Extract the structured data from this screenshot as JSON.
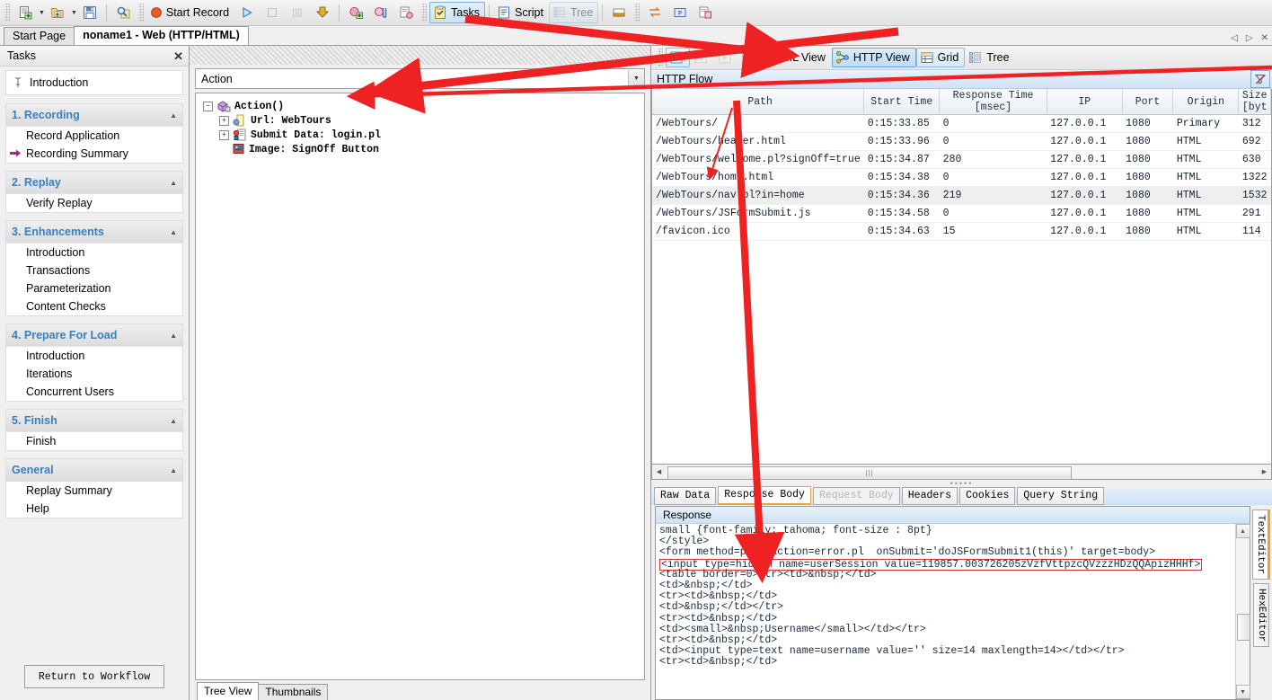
{
  "toolbar": {
    "buttons": [
      {
        "name": "new-script",
        "icon": "new-doc-icon",
        "label": "",
        "caret": true
      },
      {
        "name": "open-script",
        "icon": "open-folder-icon",
        "label": "",
        "caret": true
      },
      {
        "name": "save-script",
        "icon": "save-disk-icon",
        "label": "",
        "caret": false
      },
      {
        "name": "find",
        "icon": "search-icon",
        "label": "",
        "caret": false
      },
      {
        "name": "start-record",
        "icon": "record-dot-icon",
        "label": "Start Record",
        "caret": false
      },
      {
        "name": "replay",
        "icon": "play-icon",
        "label": "",
        "caret": false
      },
      {
        "name": "stop",
        "icon": "stop-icon",
        "label": "",
        "caret": false
      },
      {
        "name": "pause",
        "icon": "pause-icon",
        "label": "",
        "caret": false
      },
      {
        "name": "download",
        "icon": "download-icon",
        "label": "",
        "caret": false
      },
      {
        "name": "add-transaction",
        "icon": "add-transaction-icon",
        "label": "",
        "caret": false
      },
      {
        "name": "insert-rendezvous",
        "icon": "rendezvous-icon",
        "label": "",
        "caret": false
      },
      {
        "name": "insert-step",
        "icon": "insert-step-icon",
        "label": "",
        "caret": false
      },
      {
        "name": "snapshot",
        "icon": "snapshot-icon",
        "label": "",
        "caret": false
      },
      {
        "name": "tasks",
        "icon": "tasks-clipboard-icon",
        "label": "Tasks",
        "caret": false
      },
      {
        "name": "script",
        "icon": "script-doc-icon",
        "label": "Script",
        "caret": false
      },
      {
        "name": "tree",
        "icon": "tree-icon",
        "label": "Tree",
        "caret": false
      },
      {
        "name": "output-window",
        "icon": "output-pane-icon",
        "label": "",
        "caret": false
      },
      {
        "name": "swap-icon",
        "icon": "swap-arrows-icon",
        "label": "",
        "caret": false
      },
      {
        "name": "parameter-icon",
        "icon": "parameter-p-icon",
        "label": "",
        "caret": false
      },
      {
        "name": "snapshot2-icon",
        "icon": "snapshot-window-icon",
        "label": "",
        "caret": false
      }
    ],
    "labels": {
      "start_record": "Start Record",
      "tasks": "Tasks",
      "script": "Script",
      "tree": "Tree"
    }
  },
  "doc_tabs": {
    "items": [
      {
        "label": "Start Page",
        "active": false
      },
      {
        "label": "noname1 - Web (HTTP/HTML)",
        "active": true
      }
    ],
    "nav_prev": "◁",
    "nav_next": "▷",
    "close": "✕"
  },
  "tasks_panel": {
    "title": "Tasks",
    "close_label": "✕",
    "introduction": "Introduction",
    "groups": [
      {
        "title": "1. Recording",
        "items": [
          {
            "label": "Record Application",
            "current": false
          },
          {
            "label": "Recording Summary",
            "current": true
          }
        ]
      },
      {
        "title": "2. Replay",
        "items": [
          {
            "label": "Verify Replay",
            "current": false
          }
        ]
      },
      {
        "title": "3. Enhancements",
        "items": [
          {
            "label": "Introduction",
            "current": false
          },
          {
            "label": "Transactions",
            "current": false
          },
          {
            "label": "Parameterization",
            "current": false
          },
          {
            "label": "Content Checks",
            "current": false
          }
        ]
      },
      {
        "title": "4. Prepare For Load",
        "items": [
          {
            "label": "Introduction",
            "current": false
          },
          {
            "label": "Iterations",
            "current": false
          },
          {
            "label": "Concurrent Users",
            "current": false
          }
        ]
      },
      {
        "title": "5. Finish",
        "items": [
          {
            "label": "Finish",
            "current": false
          }
        ]
      },
      {
        "title": "General",
        "items": [
          {
            "label": "Replay Summary",
            "current": false
          },
          {
            "label": "Help",
            "current": false
          }
        ]
      }
    ],
    "return_button": "Return to Workflow"
  },
  "center_panel": {
    "action_combo": "Action",
    "tree": [
      {
        "label": "Action()",
        "indent": 0,
        "expander": "-",
        "icon": "action-package-icon",
        "bold": true
      },
      {
        "label": "Url: WebTours",
        "indent": 1,
        "expander": "+",
        "icon": "url-page-icon",
        "bold": true
      },
      {
        "label": "Submit Data: login.pl",
        "indent": 1,
        "expander": "+",
        "icon": "submit-data-icon",
        "bold": true
      },
      {
        "label": "Image: SignOff Button",
        "indent": 1,
        "expander": "",
        "icon": "image-icon",
        "bold": true
      }
    ],
    "tabs": [
      {
        "label": "Tree View",
        "active": true
      },
      {
        "label": "Thumbnails",
        "active": false
      }
    ]
  },
  "view_toolbar": {
    "buttons": [
      {
        "name": "record-snapshot",
        "label": "",
        "icon": "red-dot-square-icon",
        "state": "framed"
      },
      {
        "name": "prev-snapshot",
        "label": "",
        "icon": "prev-snapshot-icon",
        "state": "disabled"
      },
      {
        "name": "next-snapshot",
        "label": "",
        "icon": "next-snapshot-icon",
        "state": "disabled"
      },
      {
        "name": "html-view",
        "label": "HTML View",
        "icon": "html-view-icon",
        "state": "normal"
      },
      {
        "name": "http-view",
        "label": "HTTP View",
        "icon": "http-view-icon",
        "state": "selected"
      },
      {
        "name": "grid-view",
        "label": "Grid",
        "icon": "grid-icon",
        "state": "framed"
      },
      {
        "name": "tree-view",
        "label": "Tree",
        "icon": "tree-view-icon",
        "state": "normal"
      }
    ]
  },
  "http_flow": {
    "title": "HTTP Flow",
    "filter_icon": "filter-icon",
    "columns": [
      "Path",
      "Start Time",
      "Response Time [msec]",
      "IP",
      "Port",
      "Origin",
      "Size [byt"
    ],
    "rows": [
      {
        "path": "/WebTours/",
        "start": "0:15:33.85",
        "resp": "0",
        "ip": "127.0.0.1",
        "port": "1080",
        "origin": "Primary",
        "size": "312",
        "selected": false
      },
      {
        "path": "/WebTours/header.html",
        "start": "0:15:33.96",
        "resp": "0",
        "ip": "127.0.0.1",
        "port": "1080",
        "origin": "HTML",
        "size": "692",
        "selected": false
      },
      {
        "path": "/WebTours/welcome.pl?signOff=true",
        "start": "0:15:34.87",
        "resp": "280",
        "ip": "127.0.0.1",
        "port": "1080",
        "origin": "HTML",
        "size": "630",
        "selected": false
      },
      {
        "path": "/WebTours/home.html",
        "start": "0:15:34.38",
        "resp": "0",
        "ip": "127.0.0.1",
        "port": "1080",
        "origin": "HTML",
        "size": "1322",
        "selected": false
      },
      {
        "path": "/WebTours/nav.pl?in=home",
        "start": "0:15:34.36",
        "resp": "219",
        "ip": "127.0.0.1",
        "port": "1080",
        "origin": "HTML",
        "size": "1532",
        "selected": true
      },
      {
        "path": "/WebTours/JSFormSubmit.js",
        "start": "0:15:34.58",
        "resp": "0",
        "ip": "127.0.0.1",
        "port": "1080",
        "origin": "HTML",
        "size": "291",
        "selected": false
      },
      {
        "path": "/favicon.ico",
        "start": "0:15:34.63",
        "resp": "15",
        "ip": "127.0.0.1",
        "port": "1080",
        "origin": "HTML",
        "size": "114",
        "selected": false
      }
    ]
  },
  "detail_tabs": [
    {
      "label": "Raw Data",
      "active": false,
      "disabled": false
    },
    {
      "label": "Response Body",
      "active": true,
      "disabled": false
    },
    {
      "label": "Request Body",
      "active": false,
      "disabled": true
    },
    {
      "label": "Headers",
      "active": false,
      "disabled": false
    },
    {
      "label": "Cookies",
      "active": false,
      "disabled": false
    },
    {
      "label": "Query String",
      "active": false,
      "disabled": false
    }
  ],
  "response": {
    "title": "Response",
    "lines": [
      {
        "text": "small {font-family: tahoma; font-size : 8pt}",
        "highlight": false
      },
      {
        "text": "</style>",
        "highlight": false
      },
      {
        "text": "<form method=post action=error.pl  onSubmit='doJSFormSubmit1(this)' target=body>",
        "highlight": false
      },
      {
        "text": "<input type=hidden name=userSession value=119857.003726205zVzfVttpzcQVzzzHDzQQApizHHHf>",
        "highlight": true
      },
      {
        "text": "<table border=0><tr><td>&nbsp;</td>",
        "highlight": false
      },
      {
        "text": "<td>&nbsp;</td>",
        "highlight": false
      },
      {
        "text": "<tr><td>&nbsp;</td>",
        "highlight": false
      },
      {
        "text": "<td>&nbsp;</td></tr>",
        "highlight": false
      },
      {
        "text": "<tr><td>&nbsp;</td>",
        "highlight": false
      },
      {
        "text": "<td><small>&nbsp;Username</small></td></tr>",
        "highlight": false
      },
      {
        "text": "<tr><td>&nbsp;</td>",
        "highlight": false
      },
      {
        "text": "<td><input type=text name=username value='' size=14 maxlength=14></td></tr>",
        "highlight": false
      },
      {
        "text": "<tr><td>&nbsp;</td>",
        "highlight": false
      }
    ]
  },
  "editor_tabs": [
    {
      "label": "TextEditor",
      "active": true
    },
    {
      "label": "HexEditor",
      "active": false
    }
  ],
  "colors": {
    "accent_blue": "#3a7fc1",
    "tab_orange": "#e8a33d",
    "annotation_red": "#ee2222",
    "highlight_red": "#cc3333"
  }
}
